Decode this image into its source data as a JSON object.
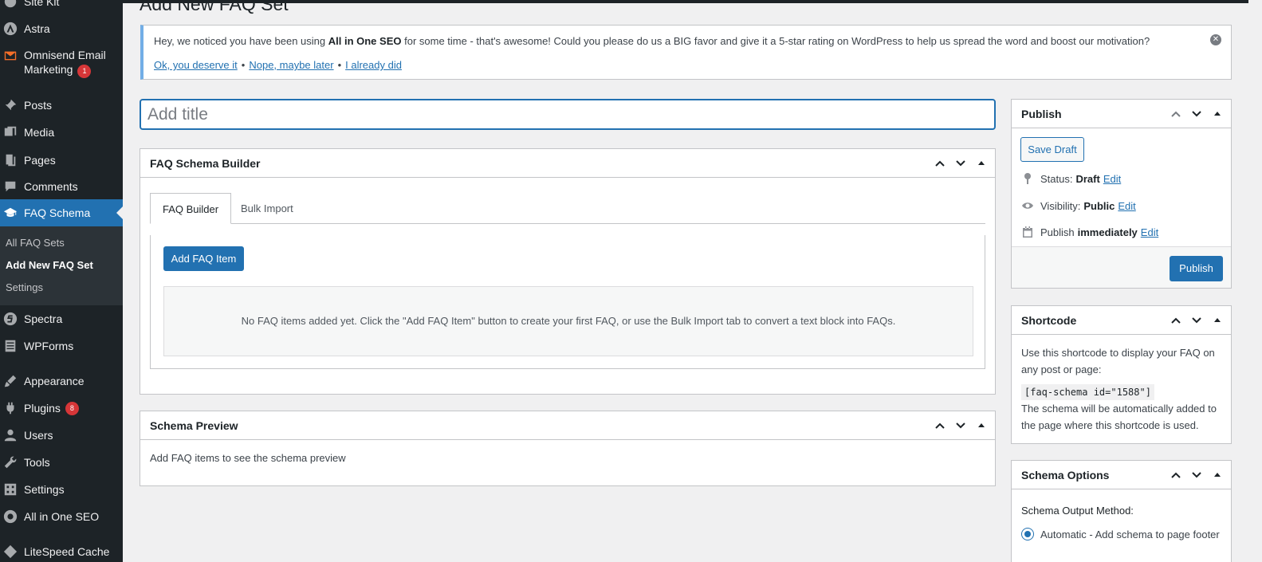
{
  "page": {
    "heading": "Add New FAQ Set"
  },
  "sidebar": {
    "items": [
      {
        "label": "Site Kit",
        "icon": "sitekit-icon"
      },
      {
        "label": "Astra",
        "icon": "astra-icon"
      },
      {
        "label": "Omnisend Email",
        "label2": "Marketing",
        "badge": "1",
        "icon": "mail-icon"
      },
      {
        "label": "Posts",
        "icon": "pin-icon"
      },
      {
        "label": "Media",
        "icon": "media-icon"
      },
      {
        "label": "Pages",
        "icon": "pages-icon"
      },
      {
        "label": "Comments",
        "icon": "comment-icon"
      },
      {
        "label": "FAQ Schema",
        "icon": "graduation-cap-icon",
        "active": true
      },
      {
        "label": "Spectra",
        "icon": "spectra-icon"
      },
      {
        "label": "WPForms",
        "icon": "forms-icon"
      },
      {
        "label": "Appearance",
        "icon": "brush-icon"
      },
      {
        "label": "Plugins",
        "badge": "8",
        "icon": "plugin-icon"
      },
      {
        "label": "Users",
        "icon": "user-icon"
      },
      {
        "label": "Tools",
        "icon": "wrench-icon"
      },
      {
        "label": "Settings",
        "icon": "settings-icon"
      },
      {
        "label": "All in One SEO",
        "icon": "aioseo-icon"
      },
      {
        "label": "LiteSpeed Cache",
        "icon": "litespeed-icon"
      }
    ],
    "submenu": [
      {
        "label": "All FAQ Sets"
      },
      {
        "label": "Add New FAQ Set",
        "current": true
      },
      {
        "label": "Settings"
      }
    ]
  },
  "notice": {
    "msg_pre": "Hey, we noticed you have been using ",
    "msg_bold": "All in One SEO",
    "msg_post": " for some time - that's awesome! Could you please do us a BIG favor and give it a 5-star rating on WordPress to help us spread the word and boost our motivation?",
    "link1": "Ok, you deserve it",
    "link2": "Nope, maybe later",
    "link3": "I already did",
    "separator": "•"
  },
  "title_input": {
    "placeholder": "Add title",
    "value": ""
  },
  "faq_builder": {
    "title": "FAQ Schema Builder",
    "tabs": [
      {
        "label": "FAQ Builder"
      },
      {
        "label": "Bulk Import"
      }
    ],
    "add_button": "Add FAQ Item",
    "empty_text": "No FAQ items added yet. Click the \"Add FAQ Item\" button to create your first FAQ, or use the Bulk Import tab to convert a text block into FAQs."
  },
  "schema_preview": {
    "title": "Schema Preview",
    "body": "Add FAQ items to see the schema preview"
  },
  "publish": {
    "title": "Publish",
    "save_draft": "Save Draft",
    "status_label": "Status:",
    "status_value": "Draft",
    "visibility_label": "Visibility:",
    "visibility_value": "Public",
    "publish_label": "Publish",
    "publish_value": "immediately",
    "edit": "Edit",
    "publish_button": "Publish"
  },
  "shortcode": {
    "title": "Shortcode",
    "intro": "Use this shortcode to display your FAQ on any post or page:",
    "code": "[faq-schema id=\"1588\"]",
    "note": "The schema will be automatically added to the page where this shortcode is used."
  },
  "schema_options": {
    "title": "Schema Options",
    "output_label": "Schema Output Method:",
    "option1": "Automatic - Add schema to page footer"
  },
  "colors": {
    "accent": "#2271b1",
    "sidebar_bg": "#1d2327",
    "badge": "#d63638",
    "notice_border": "#72aee6"
  }
}
